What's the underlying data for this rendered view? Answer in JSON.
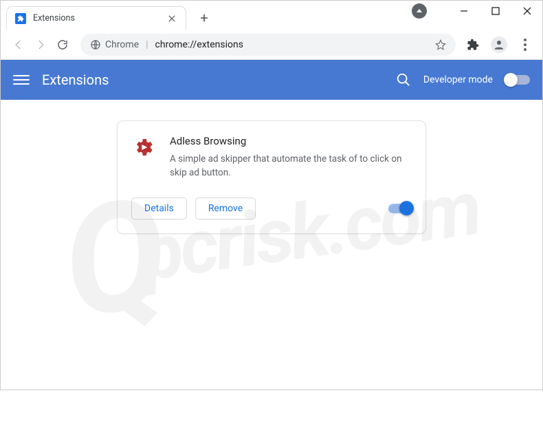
{
  "window": {
    "tab_title": "Extensions"
  },
  "omnibox": {
    "prefix": "Chrome",
    "url": "chrome://extensions"
  },
  "ext_header": {
    "title": "Extensions",
    "developer_mode_label": "Developer mode"
  },
  "extension": {
    "name": "Adless Browsing",
    "description": "A simple ad skipper that automate the task of to click on skip ad button.",
    "details_label": "Details",
    "remove_label": "Remove",
    "enabled": true
  },
  "watermark": "pcrisk.com"
}
